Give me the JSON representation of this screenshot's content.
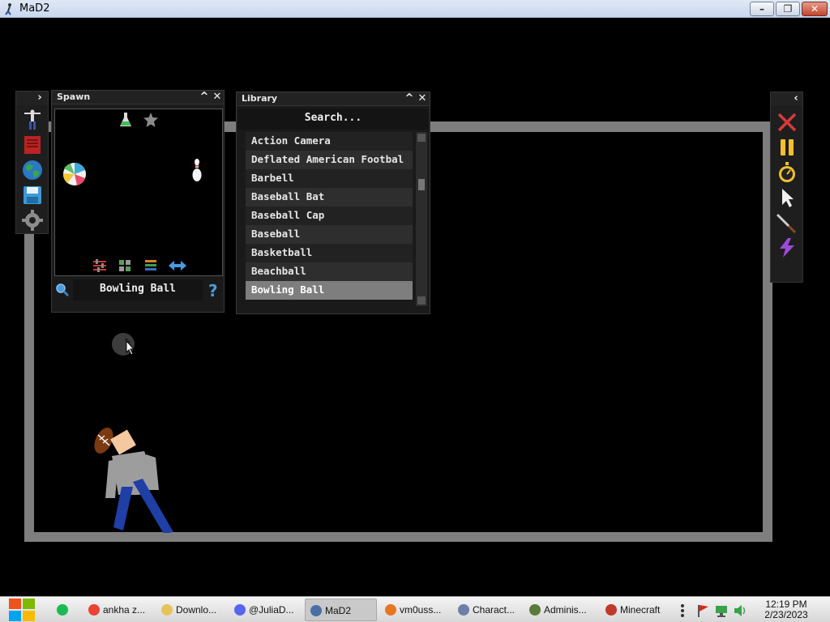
{
  "window": {
    "title": "MaD2",
    "minimize_label": "–",
    "maximize_label": "❐",
    "close_label": "✕"
  },
  "spawn_panel": {
    "title": "Spawn",
    "selected_item": "Bowling Ball",
    "collapse_label": "^",
    "close_label": "✕",
    "help_label": "?"
  },
  "library_panel": {
    "title": "Library",
    "search_placeholder": "Search...",
    "collapse_label": "^",
    "close_label": "✕",
    "items": [
      "Action Camera",
      "Deflated American Footbal",
      "Barbell",
      "Baseball Bat",
      "Baseball Cap",
      "Baseball",
      "Basketball",
      "Beachball",
      "Bowling Ball"
    ],
    "selected_index": 8
  },
  "left_toolbar": {
    "expand_label": "›",
    "icons": [
      "ragdoll-icon",
      "book-icon",
      "globe-icon",
      "save-icon",
      "gear-icon"
    ]
  },
  "right_toolbar": {
    "collapse_label": "‹",
    "icons": [
      "close-x-icon",
      "pause-icon",
      "stopwatch-icon",
      "cursor-icon",
      "knife-icon",
      "lightning-icon"
    ]
  },
  "taskbar": {
    "tasks": [
      {
        "label": "",
        "icon": "spotify-icon",
        "color": "#1db954"
      },
      {
        "label": "ankha z...",
        "icon": "chrome-icon",
        "color": "#e84335"
      },
      {
        "label": "Downlo...",
        "icon": "folder-icon",
        "color": "#e8c35a"
      },
      {
        "label": "@JuliaD...",
        "icon": "discord-icon",
        "color": "#5865f2"
      },
      {
        "label": "MaD2",
        "icon": "mad2-icon",
        "color": "#4a6fa5"
      },
      {
        "label": "vm0uss...",
        "icon": "vm-icon",
        "color": "#e87722"
      },
      {
        "label": "Charact...",
        "icon": "character-icon",
        "color": "#6b7fa8"
      },
      {
        "label": "Adminis...",
        "icon": "admin-icon",
        "color": "#5b7b3b"
      },
      {
        "label": "Minecraft",
        "icon": "java-icon",
        "color": "#c0392b"
      }
    ],
    "active_index": 4,
    "clock_time": "12:19 PM",
    "clock_date": "2/23/2023"
  },
  "colors": {
    "arena_border": "#7e7e7e",
    "panel_bg": "#1a1a1a",
    "selected_row": "#7e7e7e"
  }
}
